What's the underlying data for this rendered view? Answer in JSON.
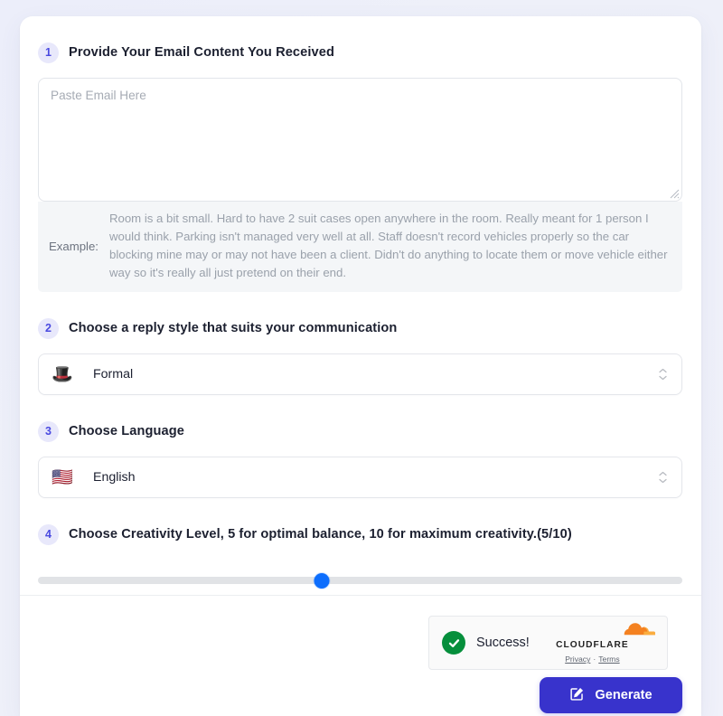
{
  "steps": [
    {
      "number": "1",
      "title": "Provide Your Email Content You Received",
      "input_placeholder": "Paste Email Here",
      "input_value": "",
      "example_label": "Example:",
      "example_text": "Room is a bit small. Hard to have 2 suit cases open anywhere in the room. Really meant for 1 person I would think. Parking isn't managed very well at all. Staff doesn't record vehicles properly so the car blocking mine may or may not have been a client. Didn't do anything to locate them or move vehicle either way so it's really all just pretend on their end."
    },
    {
      "number": "2",
      "title": "Choose a reply style that suits your communication",
      "select_emoji": "🎩",
      "select_emoji_name": "top-hat-emoji",
      "select_value": "Formal"
    },
    {
      "number": "3",
      "title": "Choose Language",
      "select_emoji": "🇺🇸",
      "select_emoji_name": "us-flag-emoji",
      "select_value": "English"
    },
    {
      "number": "4",
      "title": "Choose Creativity Level, 5 for optimal balance, 10 for maximum creativity.(5/10)",
      "slider_value": "5",
      "slider_min": "1",
      "slider_max": "10",
      "slider_percent": 44
    }
  ],
  "turnstile": {
    "status_text": "Success!",
    "brand_name": "CLOUDFLARE",
    "privacy_label": "Privacy",
    "separator": "·",
    "terms_label": "Terms"
  },
  "actions": {
    "generate_label": "Generate"
  },
  "colors": {
    "accent": "#3833cc",
    "badge_bg": "#e8e8fb",
    "badge_text": "#4a4ae0",
    "slider_thumb": "#0d6efd",
    "success_green": "#068f3c",
    "cloudflare_orange": "#f48120",
    "page_bg": "#eef0f8"
  }
}
